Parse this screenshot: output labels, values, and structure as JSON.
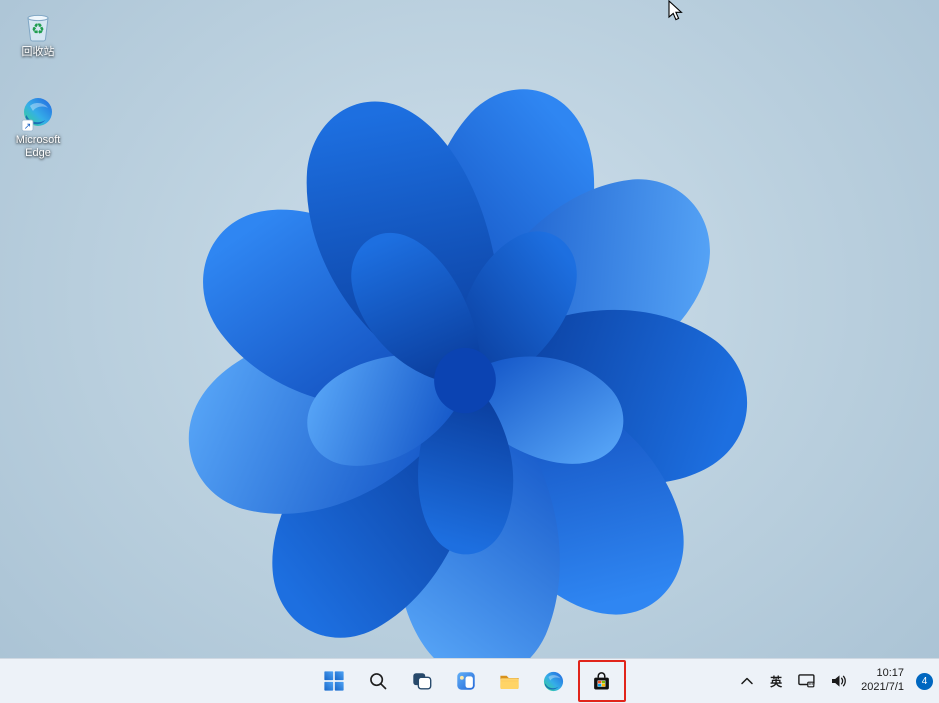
{
  "desktop": {
    "icons": [
      {
        "name": "recycle-bin",
        "label": "回收站"
      },
      {
        "name": "microsoft-edge-shortcut",
        "label": "Microsoft Edge"
      }
    ],
    "wallpaper": "windows-11-bloom"
  },
  "taskbar": {
    "buttons": [
      {
        "name": "start",
        "icon": "windows-logo-icon"
      },
      {
        "name": "search",
        "icon": "search-icon"
      },
      {
        "name": "task-view",
        "icon": "task-view-icon"
      },
      {
        "name": "widgets",
        "icon": "widgets-icon"
      },
      {
        "name": "file-explorer",
        "icon": "folder-icon"
      },
      {
        "name": "edge",
        "icon": "edge-icon"
      },
      {
        "name": "store",
        "icon": "store-bag-icon",
        "highlighted": true
      }
    ],
    "highlight_color": "#e1251b",
    "tray": {
      "ime_label": "英",
      "time": "10:17",
      "date": "2021/7/1",
      "notification_count": "4"
    }
  },
  "colors": {
    "accent": "#0067c0",
    "highlight": "#e1251b",
    "bloom_dark": "#0a3fae",
    "bloom_light": "#3b8bf5"
  }
}
